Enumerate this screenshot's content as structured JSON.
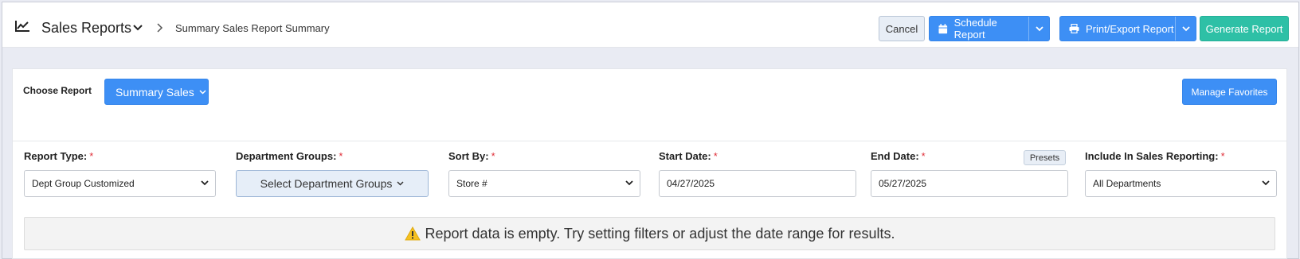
{
  "header": {
    "icon": "line-chart-icon",
    "title": "Sales Reports",
    "breadcrumb": "Summary Sales Report Summary"
  },
  "toolbar": {
    "cancel_label": "Cancel",
    "schedule_label": "Schedule Report",
    "print_label": "Print/Export Report",
    "generate_label": "Generate Report",
    "accent_blue": "#3d8ff5",
    "accent_green": "#2ec0a6"
  },
  "report_chooser": {
    "label": "Choose Report",
    "selected": "Summary Sales",
    "manage_favorites_label": "Manage Favorites"
  },
  "filters": {
    "report_type": {
      "label": "Report Type:",
      "value": "Dept Group Customized"
    },
    "department_groups": {
      "label": "Department Groups:",
      "value": "Select Department Groups"
    },
    "sort_by": {
      "label": "Sort By:",
      "value": "Store #"
    },
    "start_date": {
      "label": "Start Date:",
      "value": "04/27/2025"
    },
    "end_date": {
      "label": "End Date:",
      "value": "05/27/2025",
      "presets_label": "Presets"
    },
    "include_in_sales": {
      "label": "Include In Sales Reporting:",
      "value": "All Departments"
    },
    "required_marker": "*"
  },
  "alert": {
    "icon": "warning-icon",
    "message": "Report data is empty. Try setting filters or adjust the date range for results."
  }
}
